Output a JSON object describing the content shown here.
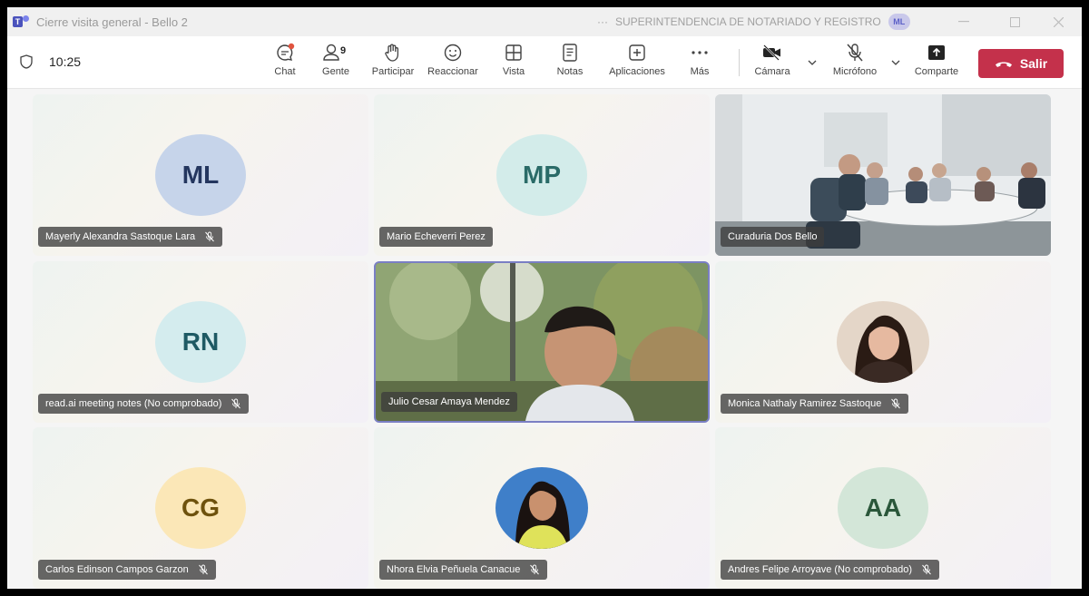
{
  "window": {
    "title": "Cierre visita general - Bello 2",
    "org": "SUPERINTENDENCIA DE NOTARIADO Y REGISTRO",
    "user_initials": "ML",
    "more_dots": "···"
  },
  "toolbar": {
    "time": "10:25",
    "chat": "Chat",
    "people": "Gente",
    "people_count": "9",
    "raise": "Participar",
    "react": "Reaccionar",
    "view": "Vista",
    "notes": "Notas",
    "apps": "Aplicaciones",
    "more": "Más",
    "camera": "Cámara",
    "mic": "Micrófono",
    "share": "Comparte",
    "leave": "Salir"
  },
  "participants": [
    {
      "initials": "ML",
      "name": "Mayerly Alexandra Sastoque Lara",
      "muted": true,
      "avatar_bg": "#c5d3ea",
      "avatar_fg": "#2d3e6b"
    },
    {
      "initials": "MP",
      "name": "Mario Echeverri Perez",
      "muted": false,
      "avatar_bg": "#d7ecea",
      "avatar_fg": "#2e6e6b"
    },
    {
      "initials": "",
      "name": "Curaduria Dos Bello",
      "muted": false,
      "video": true
    },
    {
      "initials": "RN",
      "name": "read.ai meeting notes (No comprobado)",
      "muted": true,
      "avatar_bg": "#d6ecee",
      "avatar_fg": "#1f5b66"
    },
    {
      "initials": "",
      "name": "Julio Cesar Amaya Mendez",
      "muted": false,
      "video": true,
      "active": true
    },
    {
      "initials": "",
      "name": "Monica Nathaly Ramirez Sastoque",
      "muted": true,
      "photo": true
    },
    {
      "initials": "CG",
      "name": "Carlos Edinson Campos Garzon",
      "muted": true,
      "avatar_bg": "#fbe8b9",
      "avatar_fg": "#7a5a0f"
    },
    {
      "initials": "",
      "name": "Nhora Elvia Peñuela Canacue",
      "muted": true,
      "photo": true
    },
    {
      "initials": "AA",
      "name": "Andres Felipe Arroyave (No comprobado)",
      "muted": true,
      "avatar_bg": "#d4e6d9",
      "avatar_fg": "#2d5a3c"
    }
  ]
}
